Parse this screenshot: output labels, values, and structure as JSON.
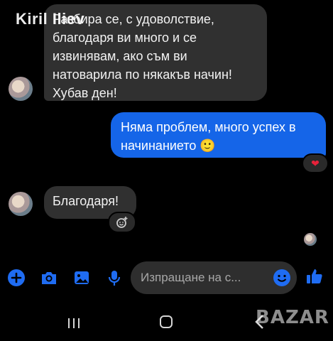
{
  "watermark": {
    "user": "Kiril Iliev"
  },
  "messages": [
    {
      "text": "Разбира се, с удоволствие, благодаря ви много и се извинявам, ако съм ви натоварила по някакъв начин! Хубав ден!",
      "direction": "incoming"
    },
    {
      "text": "Няма проблем, много успех в начинанието 🙂",
      "direction": "outgoing",
      "reaction": "heart"
    },
    {
      "text": "Благодаря!",
      "direction": "incoming",
      "reaction": "add-reaction"
    }
  ],
  "composer": {
    "placeholder": "Изпращане на с...",
    "icons": [
      "plus-icon",
      "camera-icon",
      "gallery-icon",
      "microphone-icon",
      "emoji-icon",
      "thumbs-up-icon"
    ]
  },
  "nav": {
    "icons": [
      "recent-apps-icon",
      "home-icon",
      "back-icon"
    ]
  },
  "logo": {
    "text": "BAZAR"
  },
  "colors": {
    "accent": "#1565e8",
    "incoming_bubble": "#303030",
    "background": "#000000",
    "heart": "#e8213a"
  }
}
